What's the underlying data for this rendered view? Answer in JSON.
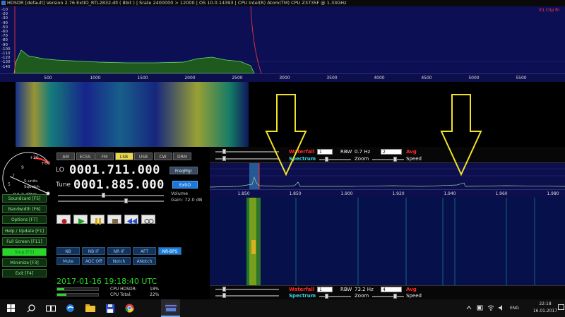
{
  "window": {
    "title": "HDSDR  [default]  Version 2.76    ExtIO_RTL2832.dll  ( 8bit )    |  Srate 2400000 > 12000   |  OS 10.0.14393    |  CPU Intel(R) Atom(TM) CPU  Z3735F @ 1.33GHz"
  },
  "top_spectrum": {
    "y_labels": [
      "-10",
      "-20",
      "-30",
      "-40",
      "-50",
      "-60",
      "-70",
      "-80",
      "-90",
      "-100",
      "-110",
      "-120",
      "-130",
      "-140"
    ],
    "clip_label": "E1 Clip Ri",
    "axis_ticks": [
      "500",
      "1000",
      "1500",
      "2000",
      "2500",
      "3000",
      "3500",
      "4000",
      "4500",
      "5000",
      "5500"
    ]
  },
  "smeter": {
    "scale_labels": [
      "+40",
      "+60",
      "+20",
      "9",
      "7",
      "5",
      "3",
      "1"
    ],
    "caption": "S-units",
    "caption2": "Squelch",
    "readout": "-84.2 dBm"
  },
  "modes": [
    {
      "label": "AM",
      "selected": false
    },
    {
      "label": "ECSS",
      "selected": false
    },
    {
      "label": "FM",
      "selected": false
    },
    {
      "label": "LSB",
      "selected": true
    },
    {
      "label": "USB",
      "selected": false
    },
    {
      "label": "CW",
      "selected": false
    },
    {
      "label": "DRM",
      "selected": false
    }
  ],
  "lo": {
    "label": "LO",
    "value": "0001.711.000",
    "button": "FreqMgr"
  },
  "tune": {
    "label": "Tune",
    "value": "0001.885.000",
    "button": "ExtIO"
  },
  "volume": {
    "label": "Volume",
    "gain": "Gain: 72.0 dB"
  },
  "transport": [
    {
      "icon": "record-icon",
      "color": "#c0182c"
    },
    {
      "icon": "play-icon",
      "color": "#18a01a"
    },
    {
      "icon": "pause-icon",
      "color": "#d8a800"
    },
    {
      "icon": "stop-icon",
      "color": "#7a6a4a"
    },
    {
      "icon": "rewind-icon",
      "color": "#2c4fd0"
    },
    {
      "icon": "loop-icon",
      "color": "#555"
    }
  ],
  "fbuttons": [
    {
      "label": "Soundcard  [F5]",
      "selected": false
    },
    {
      "label": "Bandwidth  [F6]",
      "selected": false
    },
    {
      "label": "Options  [F7]",
      "selected": false
    },
    {
      "label": "Help / Update  [F1]",
      "selected": false
    },
    {
      "label": "Full Screen  [F11]",
      "selected": false
    },
    {
      "label": "Stop  [F2]",
      "selected": true
    },
    {
      "label": "Minimize  [F3]",
      "selected": false
    },
    {
      "label": "Exit  [F4]",
      "selected": false
    }
  ],
  "dsp_row1": [
    {
      "label": "NB",
      "selected": false
    },
    {
      "label": "NB IF",
      "selected": false
    },
    {
      "label": "NR IF",
      "selected": false
    },
    {
      "label": "AFT",
      "selected": false
    },
    {
      "label": "NR-BPS",
      "selected": true
    }
  ],
  "dsp_row2": [
    {
      "label": "Mute"
    },
    {
      "label": "AGC Off"
    },
    {
      "label": "Notch"
    },
    {
      "label": "ANotch"
    }
  ],
  "datetime": "2017-01-16   19:18:40 UTC",
  "cpu": [
    {
      "label": "CPU HDSDR:",
      "value": "18%",
      "level": 0.18
    },
    {
      "label": "CPU Total:",
      "value": "22%",
      "level": 0.22
    }
  ],
  "rf_controls_top": {
    "waterfall_label": "Waterfall",
    "waterfall_value": "1",
    "rbw_label": "RBW",
    "rbw_value": "0.7 Hz",
    "avg_value": "2",
    "avg_label": "Avg",
    "spectrum_label": "Spectrum",
    "zoom_label": "Zoom",
    "speed_label": "Speed"
  },
  "rf_controls_bottom": {
    "waterfall_label": "Waterfall",
    "waterfall_value": "1",
    "rbw_label": "RBW",
    "rbw_value": "73.2 Hz",
    "avg_value": "4",
    "avg_label": "Avg",
    "spectrum_label": "Spectrum",
    "zoom_label": "Zoom",
    "speed_label": "Speed"
  },
  "rf_axis_ticks": [
    "1.850",
    "1.850",
    "1.900",
    "1.920",
    "1.940",
    "1.960",
    "1.980"
  ],
  "taskbar": {
    "icons": [
      "windows-start-icon",
      "search-icon",
      "task-view-icon",
      "edge-icon",
      "file-explorer-icon",
      "save-icon",
      "chrome-icon",
      "hdsdr-icon"
    ],
    "tray_lang": "ENG",
    "time": "22:18",
    "date": "16.01.2017"
  },
  "colors": {
    "annotation_arrow": "#f3e326",
    "spectrum_bg": "#0c0f4c",
    "accent_red": "#ff2a2a",
    "accent_cyan": "#39d6e8"
  }
}
